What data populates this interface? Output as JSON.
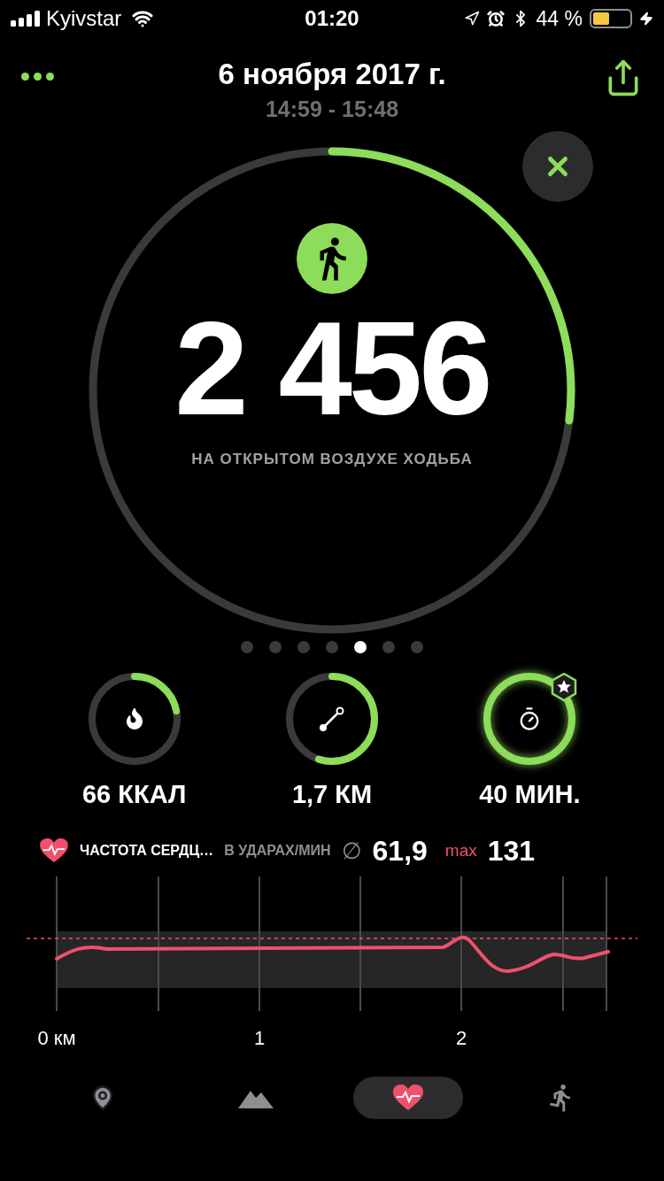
{
  "status_bar": {
    "carrier": "Kyivstar",
    "time": "01:20",
    "battery": "44 %"
  },
  "header": {
    "date": "6 ноября 2017 г.",
    "time_range": "14:59 - 15:48"
  },
  "summary": {
    "value": "2 456",
    "label": "НА ОТКРЫТОМ ВОЗДУХЕ ХОДЬБА"
  },
  "page_dots": [
    {
      "selected": false
    },
    {
      "selected": false
    },
    {
      "selected": false
    },
    {
      "selected": false
    },
    {
      "selected": true
    },
    {
      "selected": false
    },
    {
      "selected": false
    }
  ],
  "metrics": [
    {
      "kind": "calories",
      "value": "66 ККАЛ",
      "achievement": false
    },
    {
      "kind": "distance",
      "value": "1,7 КМ",
      "achievement": false
    },
    {
      "kind": "time",
      "value": "40 МИН.",
      "achievement": true
    }
  ],
  "heart_rate": {
    "title": "ЧАСТОТА СЕРДЦ…",
    "unit": "В УДАРАХ/МИН",
    "average_symbol": "∅",
    "average": "61,9",
    "max_label": "max",
    "max": "131",
    "axis_labels": [
      "0 км",
      "1",
      "2"
    ]
  },
  "tabs": [
    {
      "kind": "map",
      "selected": false
    },
    {
      "kind": "elevation",
      "selected": false
    },
    {
      "kind": "heart",
      "selected": true
    },
    {
      "kind": "activity",
      "selected": false
    }
  ]
}
